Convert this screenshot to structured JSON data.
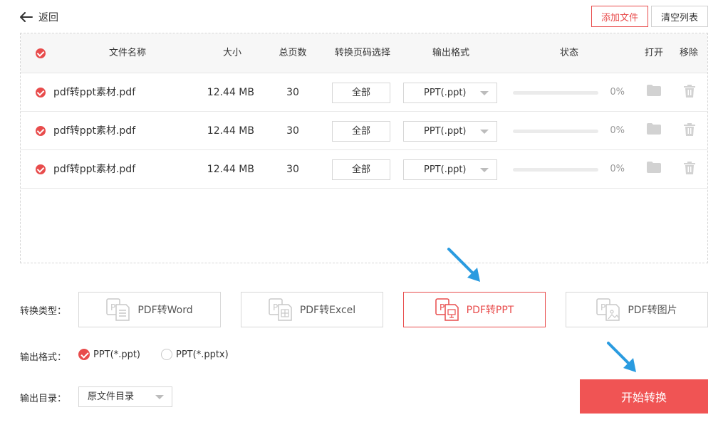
{
  "header": {
    "back_label": "返回",
    "add_file_label": "添加文件",
    "clear_list_label": "清空列表"
  },
  "table": {
    "headers": {
      "name": "文件名称",
      "size": "大小",
      "pages": "总页数",
      "page_select": "转换页码选择",
      "output_format": "输出格式",
      "status": "状态",
      "open": "打开",
      "remove": "移除"
    },
    "rows": [
      {
        "name": "pdf转ppt素材.pdf",
        "size": "12.44 MB",
        "pages": "30",
        "page_select": "全部",
        "format": "PPT(.ppt)",
        "progress": 0,
        "percent": "0%"
      },
      {
        "name": "pdf转ppt素材.pdf",
        "size": "12.44 MB",
        "pages": "30",
        "page_select": "全部",
        "format": "PPT(.ppt)",
        "progress": 0,
        "percent": "0%"
      },
      {
        "name": "pdf转ppt素材.pdf",
        "size": "12.44 MB",
        "pages": "30",
        "page_select": "全部",
        "format": "PPT(.ppt)",
        "progress": 0,
        "percent": "0%"
      }
    ]
  },
  "conversion": {
    "label": "转换类型：",
    "types": [
      {
        "label": "PDF转Word",
        "icon": "pdf-word-icon",
        "active": false
      },
      {
        "label": "PDF转Excel",
        "icon": "pdf-excel-icon",
        "active": false
      },
      {
        "label": "PDF转PPT",
        "icon": "pdf-ppt-icon",
        "active": true
      },
      {
        "label": "PDF转图片",
        "icon": "pdf-image-icon",
        "active": false
      }
    ]
  },
  "output_format": {
    "label": "输出格式：",
    "options": [
      {
        "label": "PPT(*.ppt)",
        "selected": true
      },
      {
        "label": "PPT(*.pptx)",
        "selected": false
      }
    ]
  },
  "output_dir": {
    "label": "输出目录：",
    "value": "原文件目录"
  },
  "start_button": "开始转换",
  "colors": {
    "accent": "#e84c4c",
    "start_button": "#f05454",
    "annotation_arrow": "#2a9be0"
  }
}
